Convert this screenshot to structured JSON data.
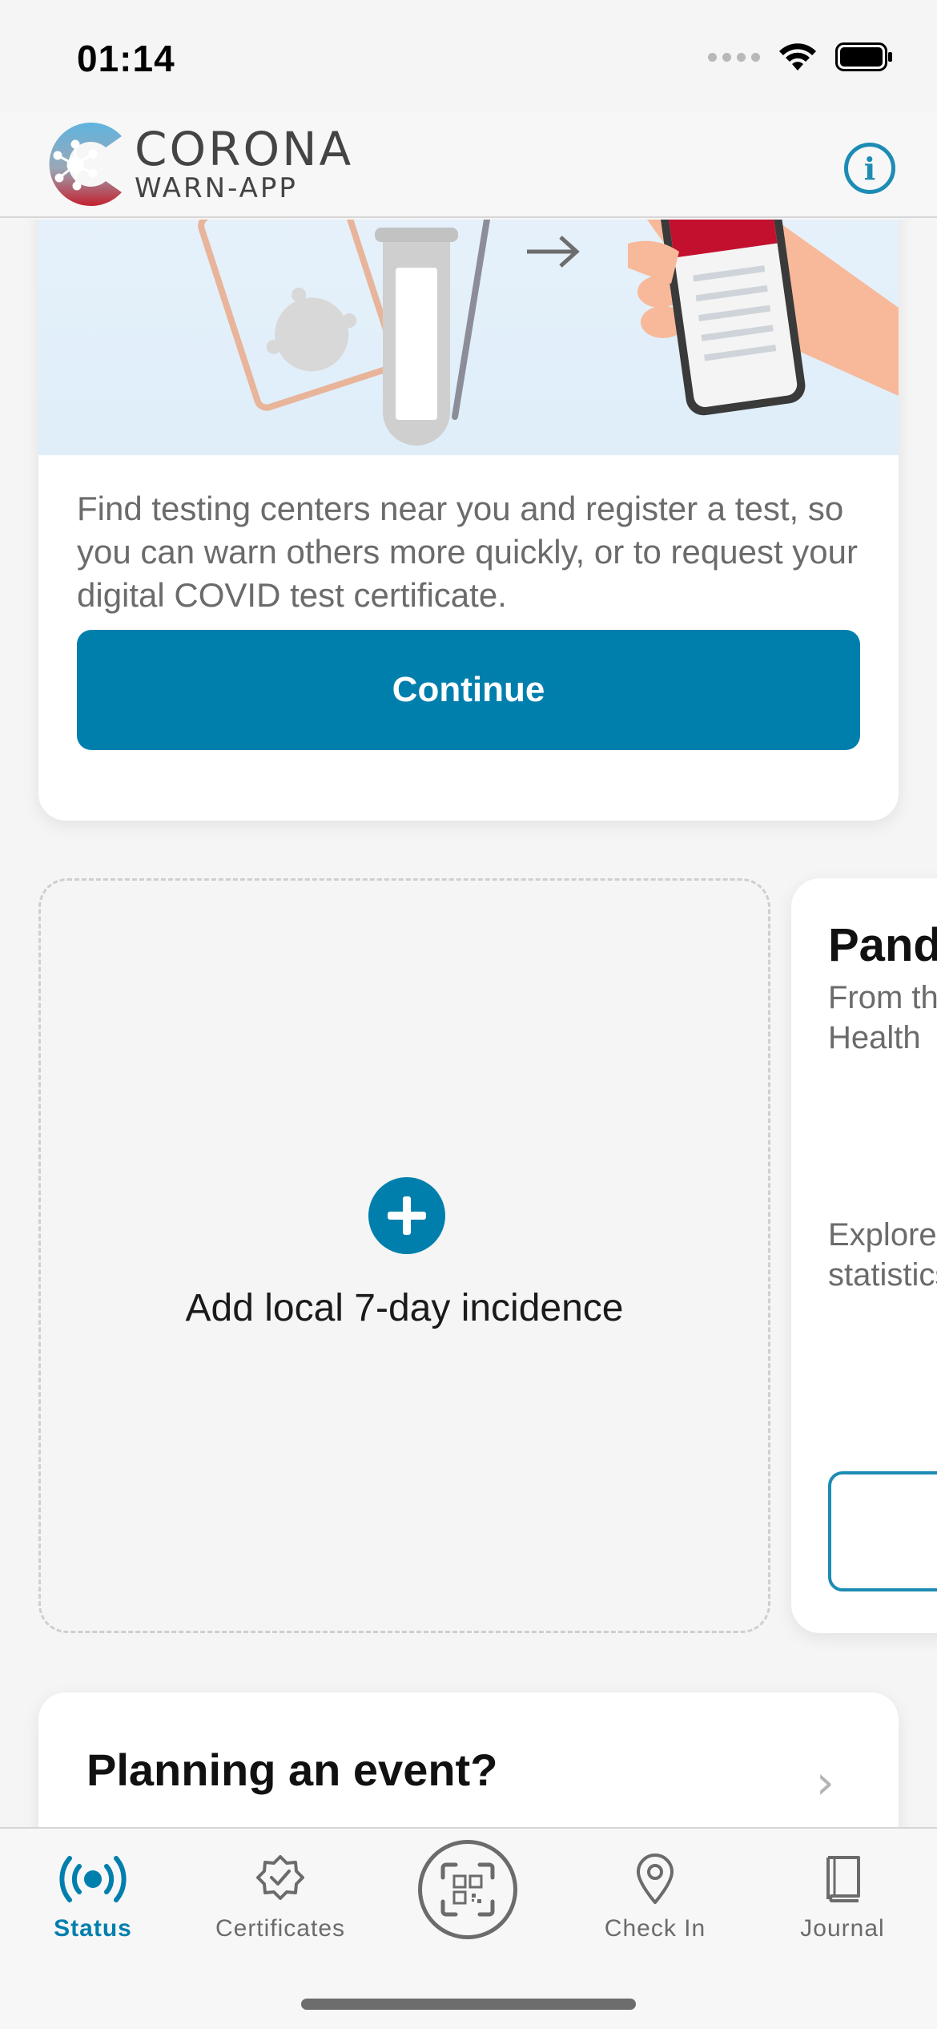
{
  "status_bar": {
    "time": "01:14"
  },
  "header": {
    "logo_title": "CORONA",
    "logo_subtitle": "WARN-APP",
    "info_icon": "info-icon"
  },
  "test_card": {
    "description": "Find testing centers near you and register a test, so you can warn others more quickly, or to request your digital COVID test certificate.",
    "button_label": "Continue"
  },
  "incidence_card": {
    "label": "Add local 7-day incidence",
    "icon": "plus-icon"
  },
  "pandemic_card": {
    "title": "Pandemic Radar",
    "subtitle": "From the Federal Ministry of Health",
    "body": "Explore current pandemic statistics"
  },
  "event_card": {
    "title": "Planning an event?"
  },
  "tab_bar": {
    "tabs": [
      {
        "label": "Status",
        "icon": "status-icon",
        "active": true
      },
      {
        "label": "Certificates",
        "icon": "certificate-icon",
        "active": false
      },
      {
        "label": "",
        "icon": "qr-scan-icon",
        "active": false
      },
      {
        "label": "Check In",
        "icon": "location-pin-icon",
        "active": false
      },
      {
        "label": "Journal",
        "icon": "book-icon",
        "active": false
      }
    ]
  },
  "colors": {
    "accent": "#007fad",
    "logo_red": "#c3212f",
    "logo_blue": "#3aa6d6"
  }
}
